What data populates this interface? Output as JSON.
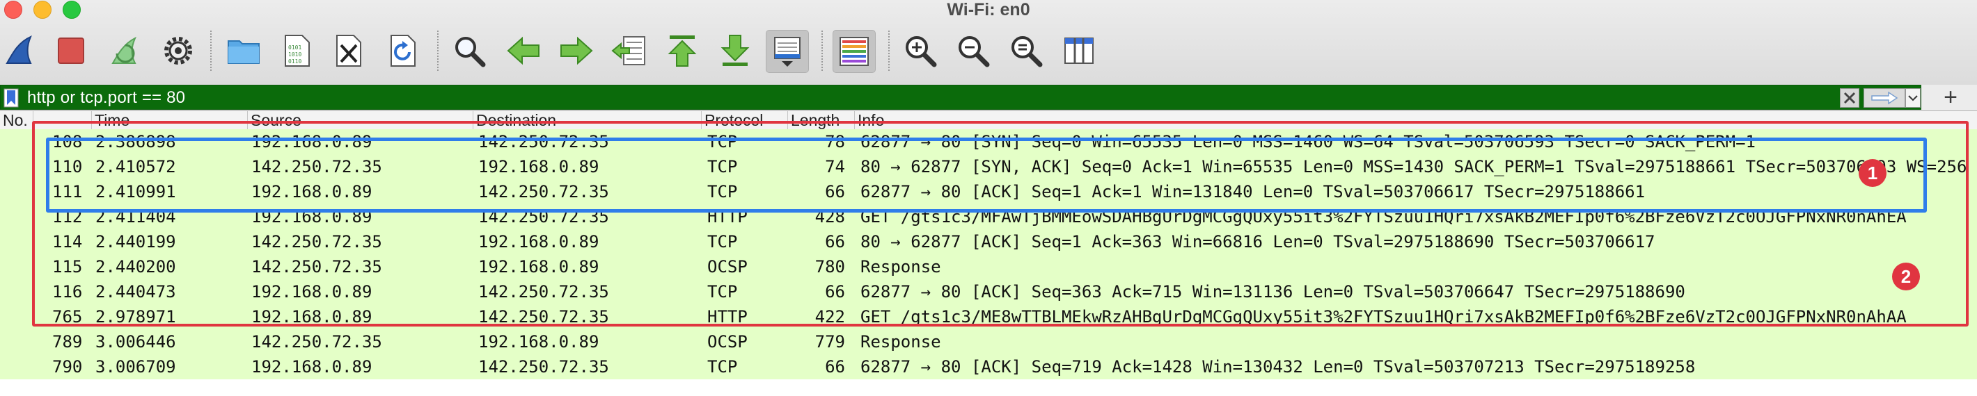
{
  "window": {
    "title": "Wi-Fi: en0"
  },
  "toolbar": {
    "buttons": [
      {
        "icon": "shark-fin-icon"
      },
      {
        "icon": "stop-icon"
      },
      {
        "icon": "restart-fin-icon"
      },
      {
        "icon": "gear-icon"
      },
      {
        "icon": "folder-icon"
      },
      {
        "icon": "document-binary-icon"
      },
      {
        "icon": "close-file-icon"
      },
      {
        "icon": "reload-icon"
      },
      {
        "icon": "search-icon"
      },
      {
        "icon": "arrow-left-icon"
      },
      {
        "icon": "arrow-right-icon"
      },
      {
        "icon": "go-to-packet-icon"
      },
      {
        "icon": "arrow-up-icon"
      },
      {
        "icon": "arrow-down-icon"
      },
      {
        "icon": "autoscroll-icon"
      },
      {
        "icon": "colorize-icon"
      },
      {
        "icon": "zoom-in-icon"
      },
      {
        "icon": "zoom-out-icon"
      },
      {
        "icon": "zoom-reset-icon"
      },
      {
        "icon": "resize-columns-icon"
      }
    ]
  },
  "filter": {
    "value": "http or tcp.port == 80"
  },
  "columns": {
    "no": "No.",
    "time": "Time",
    "source": "Source",
    "destination": "Destination",
    "protocol": "Protocol",
    "length": "Length",
    "info": "Info"
  },
  "packets": [
    {
      "no": "108",
      "time": "2.386898",
      "src": "192.168.0.89",
      "dst": "142.250.72.35",
      "proto": "TCP",
      "len": "78",
      "info": "62877 → 80 [SYN] Seq=0 Win=65535 Len=0 MSS=1460 WS=64 TSval=503706593 TSecr=0 SACK_PERM=1"
    },
    {
      "no": "110",
      "time": "2.410572",
      "src": "142.250.72.35",
      "dst": "192.168.0.89",
      "proto": "TCP",
      "len": "74",
      "info": "80 → 62877 [SYN, ACK] Seq=0 Ack=1 Win=65535 Len=0 MSS=1430 SACK_PERM=1 TSval=2975188661 TSecr=503706593 WS=256"
    },
    {
      "no": "111",
      "time": "2.410991",
      "src": "192.168.0.89",
      "dst": "142.250.72.35",
      "proto": "TCP",
      "len": "66",
      "info": "62877 → 80 [ACK] Seq=1 Ack=1 Win=131840 Len=0 TSval=503706617 TSecr=2975188661"
    },
    {
      "no": "112",
      "time": "2.411404",
      "src": "192.168.0.89",
      "dst": "142.250.72.35",
      "proto": "HTTP",
      "len": "428",
      "info": "GET /gts1c3/MFAwTjBMMEowSDAHBgUrDgMCGgQUxy55it3%2FYTSzuu1HQri7xsAkB2MEFIp0f6%2BFze6VzT2c0OJGFPNxNR0nAhEA"
    },
    {
      "no": "114",
      "time": "2.440199",
      "src": "142.250.72.35",
      "dst": "192.168.0.89",
      "proto": "TCP",
      "len": "66",
      "info": "80 → 62877 [ACK] Seq=1 Ack=363 Win=66816 Len=0 TSval=2975188690 TSecr=503706617"
    },
    {
      "no": "115",
      "time": "2.440200",
      "src": "142.250.72.35",
      "dst": "192.168.0.89",
      "proto": "OCSP",
      "len": "780",
      "info": "Response"
    },
    {
      "no": "116",
      "time": "2.440473",
      "src": "192.168.0.89",
      "dst": "142.250.72.35",
      "proto": "TCP",
      "len": "66",
      "info": "62877 → 80 [ACK] Seq=363 Ack=715 Win=131136 Len=0 TSval=503706647 TSecr=2975188690"
    },
    {
      "no": "765",
      "time": "2.978971",
      "src": "192.168.0.89",
      "dst": "142.250.72.35",
      "proto": "HTTP",
      "len": "422",
      "info": "GET /gts1c3/ME8wTTBLMEkwRzAHBgUrDgMCGgQUxy55it3%2FYTSzuu1HQri7xsAkB2MEFIp0f6%2BFze6VzT2c0OJGFPNxNR0nAhAA"
    },
    {
      "no": "789",
      "time": "3.006446",
      "src": "142.250.72.35",
      "dst": "192.168.0.89",
      "proto": "OCSP",
      "len": "779",
      "info": "Response"
    },
    {
      "no": "790",
      "time": "3.006709",
      "src": "192.168.0.89",
      "dst": "142.250.72.35",
      "proto": "TCP",
      "len": "66",
      "info": "62877 → 80 [ACK] Seq=719 Ack=1428 Win=130432 Len=0 TSval=503707213 TSecr=2975189258"
    }
  ],
  "annotations": {
    "badge1": "1",
    "badge2": "2"
  },
  "colors": {
    "filter_valid_bg": "#0b6b0b",
    "row_bg": "#e4ffc7",
    "annotation_red": "#e03540",
    "annotation_blue": "#2f7dea"
  }
}
